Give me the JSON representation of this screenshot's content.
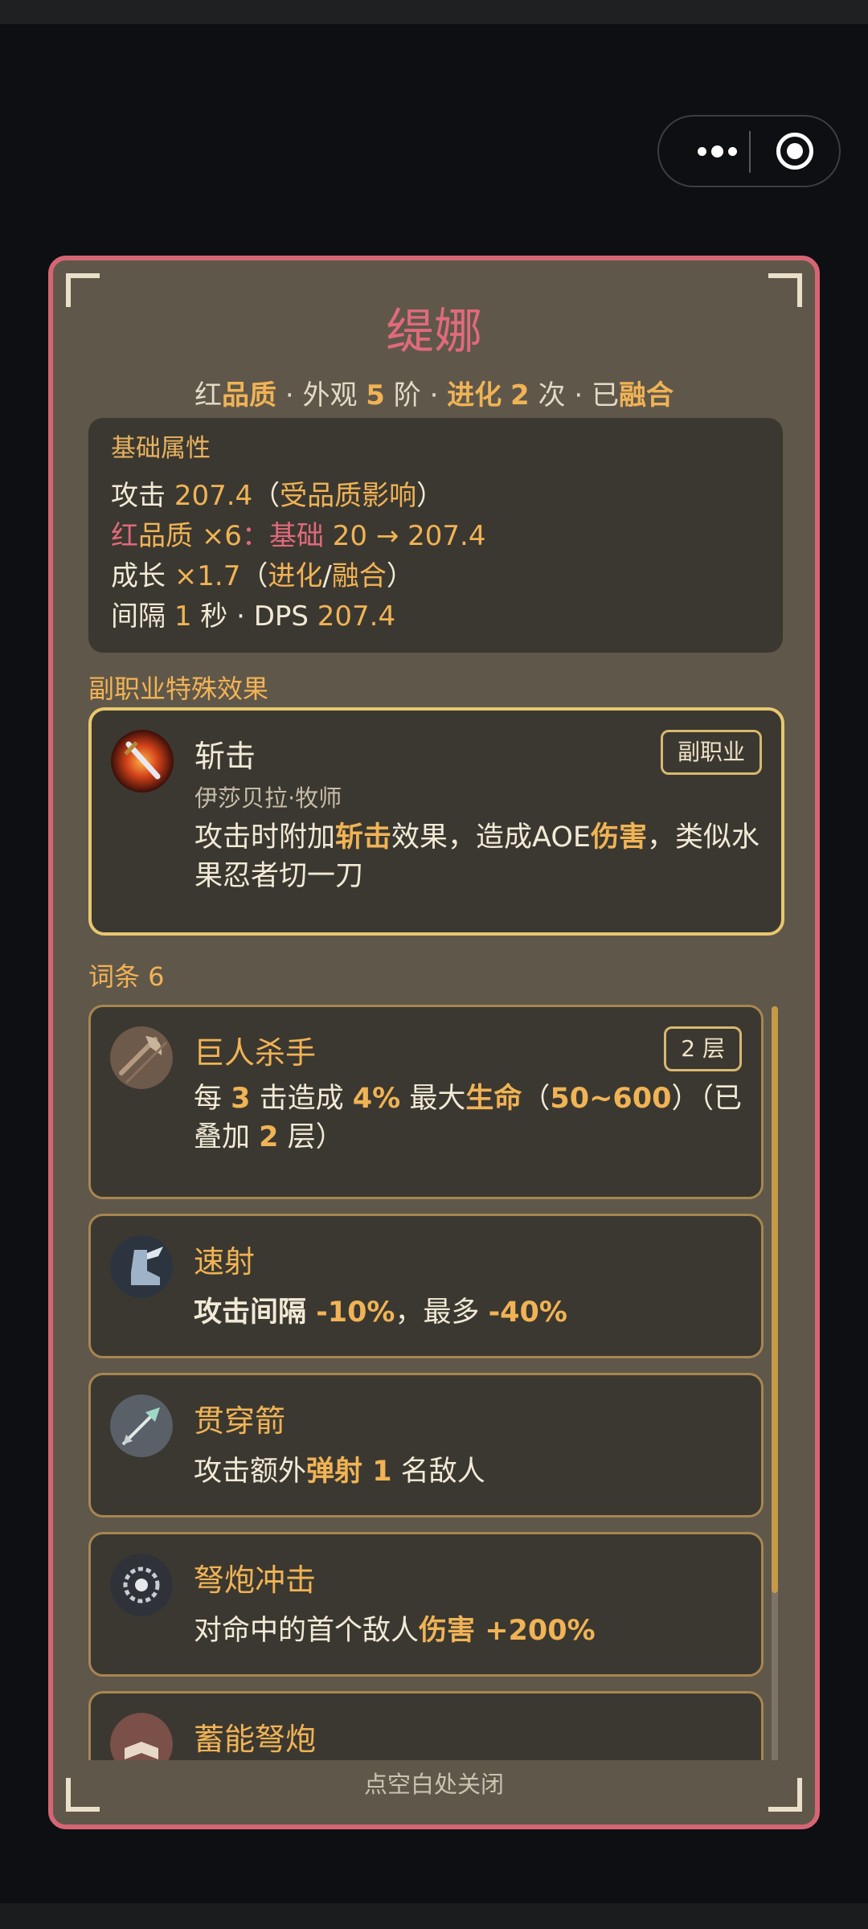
{
  "miniprogram": {
    "more_icon": "more-dots-icon",
    "close_icon": "target-circle-icon"
  },
  "card": {
    "name": "缇娜",
    "summary": {
      "quality_prefix": "红",
      "quality_word": "品质",
      "appearance_label": "外观",
      "appearance_stage": "5",
      "appearance_unit": "阶",
      "evolve_label": "进化",
      "evolve_count": "2",
      "evolve_unit": "次",
      "fused_prefix": "已",
      "fused_word": "融合"
    },
    "base_attrs": {
      "heading": "基础属性",
      "attack_label": "攻击",
      "attack_value": "207.4",
      "attack_note_open": "（",
      "attack_note": "受品质影响",
      "attack_note_close": "）",
      "quality_red": "红",
      "quality_word": "品质",
      "quality_mult": "×6",
      "quality_colon": "：",
      "quality_base_label": "基础",
      "quality_base": "20",
      "quality_arrow": "→",
      "quality_result": "207.4",
      "growth_label": "成长",
      "growth_value": "×1.7",
      "growth_paren_open": "（",
      "growth_evolve": "进化",
      "growth_slash": "/",
      "growth_fuse": "融合",
      "growth_paren_close": "）",
      "interval_label": "间隔",
      "interval_value": "1",
      "interval_unit": "秒",
      "dps_label": "DPS",
      "dps_value": "207.4"
    },
    "subjob_heading": "副职业特殊效果",
    "subjob": {
      "title": "斩击",
      "source": "伊莎贝拉·牧师",
      "badge": "副职业",
      "icon": "slash-sword-icon",
      "desc_1": "攻击时附加",
      "desc_kw1": "斩击",
      "desc_2": "效果，造成AOE",
      "desc_kw2": "伤害",
      "desc_3": "，类似水果忍者切一刀"
    },
    "traits_heading": "词条 6",
    "traits": [
      {
        "title": "巨人杀手",
        "badge": "2 层",
        "icon": "giant-axe-icon",
        "d1": "每 ",
        "n1": "3",
        "d2": " 击造成 ",
        "n2": "4%",
        "d3": " 最大",
        "k1": "生命",
        "d4": "（",
        "n3": "50~600",
        "d5": "）（已叠加 ",
        "n4": "2",
        "d6": " 层）"
      },
      {
        "title": "速射",
        "icon": "winged-boot-icon",
        "k1": "攻击间隔",
        "n1": " -10%",
        "d1": "，最多 ",
        "n2": "-40%"
      },
      {
        "title": "贯穿箭",
        "icon": "piercing-arrow-icon",
        "d1": "攻击额外",
        "k1": "弹射",
        "n1": " 1",
        "d2": " 名敌人"
      },
      {
        "title": "弩炮冲击",
        "icon": "ballista-impact-icon",
        "d1": "对命中的首个敌人",
        "k1": "伤害",
        "n1": " +200%"
      },
      {
        "title": "蓄能弩炮",
        "icon": "charged-ballista-icon"
      }
    ],
    "close_hint": "点空白处关闭"
  },
  "colors": {
    "page_bg": "#0d0f12",
    "panel_bg": "#5f574a",
    "panel_border": "#d66574",
    "inner_bg": "#3b3831",
    "gold": "#f0b355",
    "title_red": "#e06a7b"
  }
}
